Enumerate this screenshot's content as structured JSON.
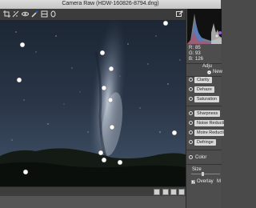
{
  "window": {
    "title": "Camera Raw (HDW-160826-8794.dng)"
  },
  "toolbar": {
    "tools": [
      "crop-icon",
      "straighten-icon",
      "red-eye-icon",
      "adjustment-brush-icon",
      "graduated-filter-icon",
      "radial-filter-icon"
    ]
  },
  "histogram": {
    "r_label": "R:",
    "r_value": "85",
    "g_label": "G:",
    "g_value": "93",
    "b_label": "B:",
    "b_value": "126"
  },
  "panel": {
    "heading": "Adju",
    "mode_label": "New",
    "rows": [
      {
        "label": "Clarity"
      },
      {
        "label": "Dehaze"
      },
      {
        "label": "Saturation"
      },
      {
        "label": "Sharpness"
      },
      {
        "label": "Noise Reduction"
      },
      {
        "label": "Moire Reduction"
      },
      {
        "label": "Defringe"
      }
    ],
    "color_label": "Color",
    "size_label": "Size",
    "overlay_label": "Overlay",
    "mask_label": "M"
  },
  "colors": {
    "accent": "#2d6cd3",
    "pin": "#ffffff",
    "panel_bg": "#4d4d4d"
  }
}
